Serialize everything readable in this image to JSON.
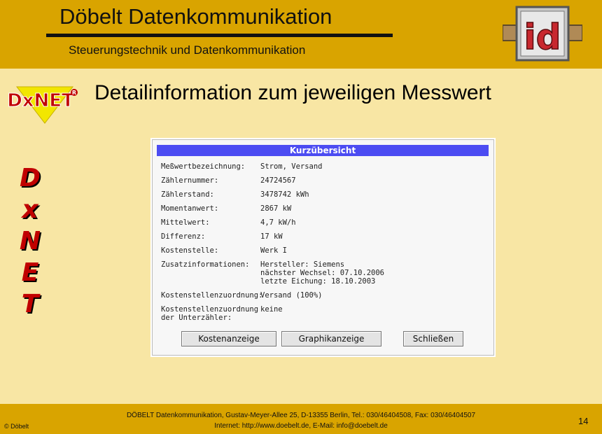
{
  "header": {
    "company": "Döbelt Datenkommunikation",
    "subtitle": "Steuerungstechnik und Datenkommunikation",
    "logo_text": "id"
  },
  "brand": {
    "dxnet_logo": "DxNET",
    "vertical_letters": [
      "D",
      "x",
      "N",
      "E",
      "T"
    ]
  },
  "heading": "Detailinformation zum jeweiligen Messwert",
  "dialog": {
    "title": "Kurzübersicht",
    "rows": [
      {
        "label": "Meßwertbezeichnung:",
        "value": "Strom, Versand"
      },
      {
        "label": "Zählernummer:",
        "value": "24724567"
      },
      {
        "label": "Zählerstand:",
        "value": "3478742 kWh"
      },
      {
        "label": "Momentanwert:",
        "value": "2867 kW"
      },
      {
        "label": "Mittelwert:",
        "value": "4,7 kW/h"
      },
      {
        "label": "Differenz:",
        "value": "17 kW"
      },
      {
        "label": "Kostenstelle:",
        "value": "Werk I"
      },
      {
        "label": "Zusatzinformationen:",
        "value": "Hersteller: Siemens\nnächster Wechsel: 07.10.2006\nletzte Eichung: 18.10.2003"
      },
      {
        "label": "Kostenstellenzuordnung:",
        "value": "Versand (100%)"
      },
      {
        "label": "Kostenstellenzuordnung\nder Unterzähler:",
        "value": "keine"
      }
    ],
    "buttons": {
      "cost": "Kostenanzeige",
      "graph": "Graphikanzeige",
      "close": "Schließen"
    }
  },
  "footer": {
    "address": "DÖBELT Datenkommunikation, Gustav-Meyer-Allee 25, D-13355 Berlin, Tel.: 030/46404508, Fax: 030/46404507",
    "contact": "Internet: http://www.doebelt.de, E-Mail: info@doebelt.de",
    "copyright": "© Döbelt",
    "page_number": "14"
  },
  "colors": {
    "band": "#d9a400",
    "background": "#f8e6a4",
    "dialog_title": "#4c4cf2",
    "brand_red": "#c00000"
  }
}
